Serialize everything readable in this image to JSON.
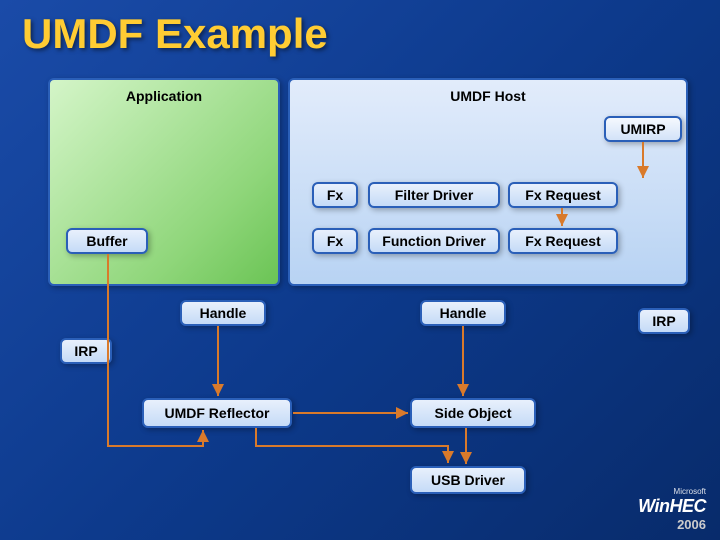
{
  "title": "UMDF Example",
  "boxes": {
    "application": "Application",
    "umdf_host": "UMDF Host",
    "umirp": "UMIRP",
    "fx1": "Fx",
    "filter_driver": "Filter Driver",
    "fx_request1": "Fx Request",
    "buffer": "Buffer",
    "fx2": "Fx",
    "function_driver": "Function Driver",
    "fx_request2": "Fx Request",
    "handle1": "Handle",
    "handle2": "Handle",
    "irp1": "IRP",
    "irp2": "IRP",
    "umdf_reflector": "UMDF Reflector",
    "side_object": "Side Object",
    "usb_driver": "USB Driver"
  },
  "logo": {
    "company": "Microsoft",
    "brand": "WinHEC",
    "year": "2006"
  }
}
